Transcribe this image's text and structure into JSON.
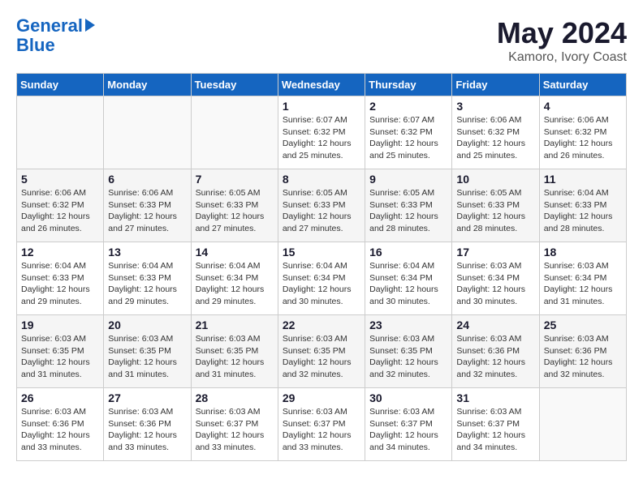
{
  "header": {
    "logo_line1": "General",
    "logo_line2": "Blue",
    "month": "May 2024",
    "location": "Kamoro, Ivory Coast"
  },
  "days_of_week": [
    "Sunday",
    "Monday",
    "Tuesday",
    "Wednesday",
    "Thursday",
    "Friday",
    "Saturday"
  ],
  "weeks": [
    [
      {
        "day": "",
        "info": ""
      },
      {
        "day": "",
        "info": ""
      },
      {
        "day": "",
        "info": ""
      },
      {
        "day": "1",
        "info": "Sunrise: 6:07 AM\nSunset: 6:32 PM\nDaylight: 12 hours\nand 25 minutes."
      },
      {
        "day": "2",
        "info": "Sunrise: 6:07 AM\nSunset: 6:32 PM\nDaylight: 12 hours\nand 25 minutes."
      },
      {
        "day": "3",
        "info": "Sunrise: 6:06 AM\nSunset: 6:32 PM\nDaylight: 12 hours\nand 25 minutes."
      },
      {
        "day": "4",
        "info": "Sunrise: 6:06 AM\nSunset: 6:32 PM\nDaylight: 12 hours\nand 26 minutes."
      }
    ],
    [
      {
        "day": "5",
        "info": "Sunrise: 6:06 AM\nSunset: 6:32 PM\nDaylight: 12 hours\nand 26 minutes."
      },
      {
        "day": "6",
        "info": "Sunrise: 6:06 AM\nSunset: 6:33 PM\nDaylight: 12 hours\nand 27 minutes."
      },
      {
        "day": "7",
        "info": "Sunrise: 6:05 AM\nSunset: 6:33 PM\nDaylight: 12 hours\nand 27 minutes."
      },
      {
        "day": "8",
        "info": "Sunrise: 6:05 AM\nSunset: 6:33 PM\nDaylight: 12 hours\nand 27 minutes."
      },
      {
        "day": "9",
        "info": "Sunrise: 6:05 AM\nSunset: 6:33 PM\nDaylight: 12 hours\nand 28 minutes."
      },
      {
        "day": "10",
        "info": "Sunrise: 6:05 AM\nSunset: 6:33 PM\nDaylight: 12 hours\nand 28 minutes."
      },
      {
        "day": "11",
        "info": "Sunrise: 6:04 AM\nSunset: 6:33 PM\nDaylight: 12 hours\nand 28 minutes."
      }
    ],
    [
      {
        "day": "12",
        "info": "Sunrise: 6:04 AM\nSunset: 6:33 PM\nDaylight: 12 hours\nand 29 minutes."
      },
      {
        "day": "13",
        "info": "Sunrise: 6:04 AM\nSunset: 6:33 PM\nDaylight: 12 hours\nand 29 minutes."
      },
      {
        "day": "14",
        "info": "Sunrise: 6:04 AM\nSunset: 6:34 PM\nDaylight: 12 hours\nand 29 minutes."
      },
      {
        "day": "15",
        "info": "Sunrise: 6:04 AM\nSunset: 6:34 PM\nDaylight: 12 hours\nand 30 minutes."
      },
      {
        "day": "16",
        "info": "Sunrise: 6:04 AM\nSunset: 6:34 PM\nDaylight: 12 hours\nand 30 minutes."
      },
      {
        "day": "17",
        "info": "Sunrise: 6:03 AM\nSunset: 6:34 PM\nDaylight: 12 hours\nand 30 minutes."
      },
      {
        "day": "18",
        "info": "Sunrise: 6:03 AM\nSunset: 6:34 PM\nDaylight: 12 hours\nand 31 minutes."
      }
    ],
    [
      {
        "day": "19",
        "info": "Sunrise: 6:03 AM\nSunset: 6:35 PM\nDaylight: 12 hours\nand 31 minutes."
      },
      {
        "day": "20",
        "info": "Sunrise: 6:03 AM\nSunset: 6:35 PM\nDaylight: 12 hours\nand 31 minutes."
      },
      {
        "day": "21",
        "info": "Sunrise: 6:03 AM\nSunset: 6:35 PM\nDaylight: 12 hours\nand 31 minutes."
      },
      {
        "day": "22",
        "info": "Sunrise: 6:03 AM\nSunset: 6:35 PM\nDaylight: 12 hours\nand 32 minutes."
      },
      {
        "day": "23",
        "info": "Sunrise: 6:03 AM\nSunset: 6:35 PM\nDaylight: 12 hours\nand 32 minutes."
      },
      {
        "day": "24",
        "info": "Sunrise: 6:03 AM\nSunset: 6:36 PM\nDaylight: 12 hours\nand 32 minutes."
      },
      {
        "day": "25",
        "info": "Sunrise: 6:03 AM\nSunset: 6:36 PM\nDaylight: 12 hours\nand 32 minutes."
      }
    ],
    [
      {
        "day": "26",
        "info": "Sunrise: 6:03 AM\nSunset: 6:36 PM\nDaylight: 12 hours\nand 33 minutes."
      },
      {
        "day": "27",
        "info": "Sunrise: 6:03 AM\nSunset: 6:36 PM\nDaylight: 12 hours\nand 33 minutes."
      },
      {
        "day": "28",
        "info": "Sunrise: 6:03 AM\nSunset: 6:37 PM\nDaylight: 12 hours\nand 33 minutes."
      },
      {
        "day": "29",
        "info": "Sunrise: 6:03 AM\nSunset: 6:37 PM\nDaylight: 12 hours\nand 33 minutes."
      },
      {
        "day": "30",
        "info": "Sunrise: 6:03 AM\nSunset: 6:37 PM\nDaylight: 12 hours\nand 34 minutes."
      },
      {
        "day": "31",
        "info": "Sunrise: 6:03 AM\nSunset: 6:37 PM\nDaylight: 12 hours\nand 34 minutes."
      },
      {
        "day": "",
        "info": ""
      }
    ]
  ]
}
